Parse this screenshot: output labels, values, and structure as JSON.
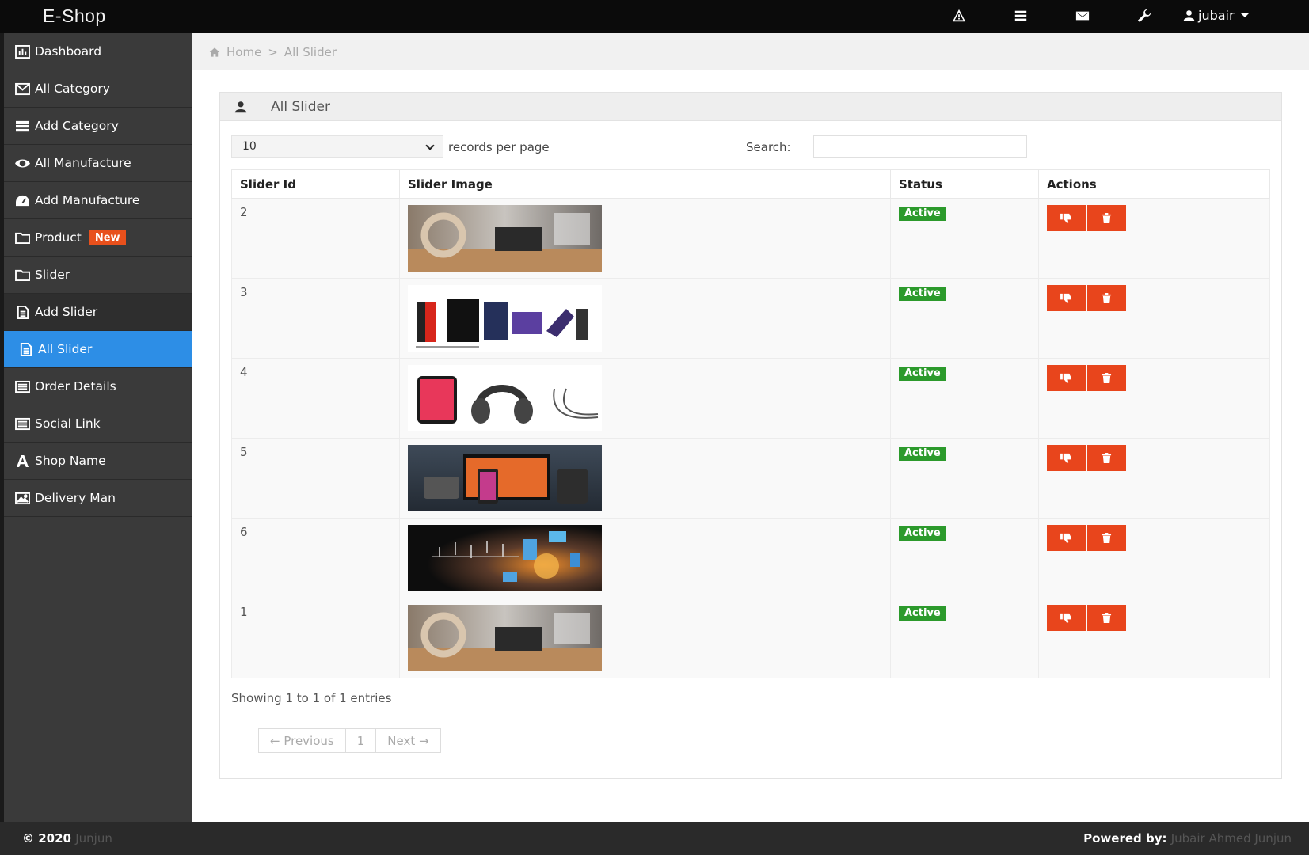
{
  "app": {
    "brand": "E-Shop"
  },
  "topbar": {
    "icons": [
      "warning-icon",
      "tasks-icon",
      "envelope-icon",
      "wrench-icon"
    ],
    "user": "jubair"
  },
  "sidebar": {
    "items": [
      {
        "label": "Dashboard",
        "icon": "bar-chart-icon"
      },
      {
        "label": "All Category",
        "icon": "envelope-icon"
      },
      {
        "label": "Add Category",
        "icon": "list-icon"
      },
      {
        "label": "All Manufacture",
        "icon": "eye-icon"
      },
      {
        "label": "Add Manufacture",
        "icon": "dashboard-icon"
      },
      {
        "label": "Product",
        "icon": "folder-icon",
        "badge": "New"
      },
      {
        "label": "Slider",
        "icon": "folder-icon"
      },
      {
        "label": "Add Slider",
        "icon": "file-icon"
      },
      {
        "label": "All Slider",
        "icon": "file-icon",
        "active": true
      },
      {
        "label": "Order Details",
        "icon": "list-alt-icon"
      },
      {
        "label": "Social Link",
        "icon": "list-alt-icon"
      },
      {
        "label": "Shop Name",
        "icon": "font-icon"
      },
      {
        "label": "Delivery Man",
        "icon": "picture-icon"
      }
    ]
  },
  "breadcrumb": {
    "home": "Home",
    "separator": ">",
    "current": "All Slider"
  },
  "panel": {
    "title": "All Slider"
  },
  "table_controls": {
    "page_length": "10",
    "page_length_label": "records per page",
    "search_label": "Search:",
    "search_value": ""
  },
  "table": {
    "headers": [
      "Slider Id",
      "Slider Image",
      "Status",
      "Actions"
    ],
    "rows": [
      {
        "id": "2",
        "image": "headphones-desk",
        "status": "Active"
      },
      {
        "id": "3",
        "image": "electronics-cases",
        "status": "Active"
      },
      {
        "id": "4",
        "image": "phone-headphones-earbuds",
        "status": "Active"
      },
      {
        "id": "5",
        "image": "apple-devices",
        "status": "Active"
      },
      {
        "id": "6",
        "image": "digital-network",
        "status": "Active"
      },
      {
        "id": "1",
        "image": "headphones-desk",
        "status": "Active"
      }
    ]
  },
  "table_info": "Showing 1 to 1 of 1 entries",
  "pagination": {
    "previous": "← Previous",
    "page": "1",
    "next": "Next →"
  },
  "footer": {
    "copyright": "© 2020",
    "copyright_name": "Junjun",
    "powered_label": "Powered by:",
    "powered_name": "Jubair Ahmed Junjun"
  },
  "colors": {
    "topbar": "#0b0b0b",
    "sidebar": "#3a3a3a",
    "active_item": "#2d8ee6",
    "badge_new": "#e8501c",
    "status_active": "#2c9a2c",
    "action_button": "#e8451c"
  }
}
